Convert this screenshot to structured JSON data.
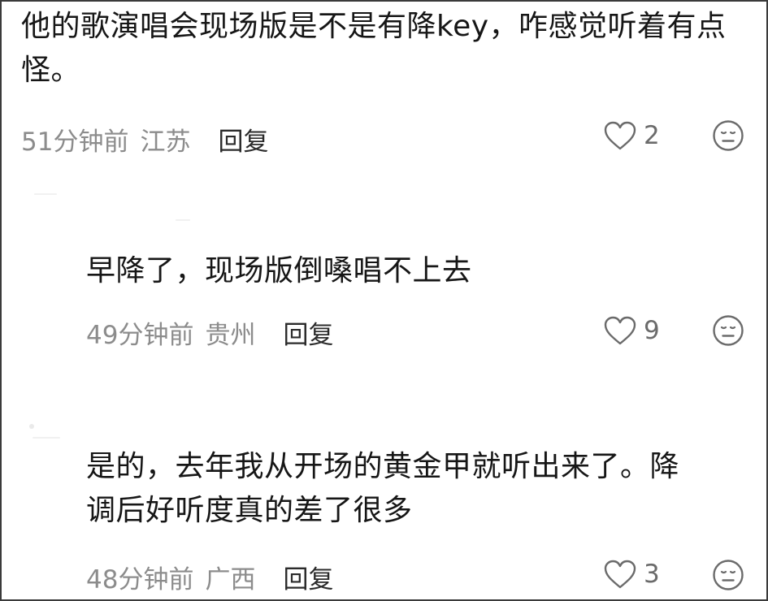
{
  "comments": [
    {
      "text": "他的歌演唱会现场版是不是有降key，咋感觉听着有点怪。",
      "time": "51分钟前",
      "location": "江苏",
      "reply_label": "回复",
      "likes": "2",
      "like_icon": "heart-outline-icon",
      "dislike_icon": "meh-face-icon"
    },
    {
      "text": "早降了，现场版倒嗓唱不上去",
      "time": "49分钟前",
      "location": "贵州",
      "reply_label": "回复",
      "likes": "9",
      "like_icon": "heart-outline-icon",
      "dislike_icon": "meh-face-icon"
    },
    {
      "text": "是的，去年我从开场的黄金甲就听出来了。降调后好听度真的差了很多",
      "time": "48分钟前",
      "location": "广西",
      "reply_label": "回复",
      "likes": "3",
      "like_icon": "heart-outline-icon",
      "dislike_icon": "meh-face-icon"
    }
  ],
  "colors": {
    "text": "#161616",
    "meta": "#8c8c8c",
    "reply": "#2b2b2b",
    "icon": "#6b6b6b",
    "border": "#3a3a3a"
  }
}
